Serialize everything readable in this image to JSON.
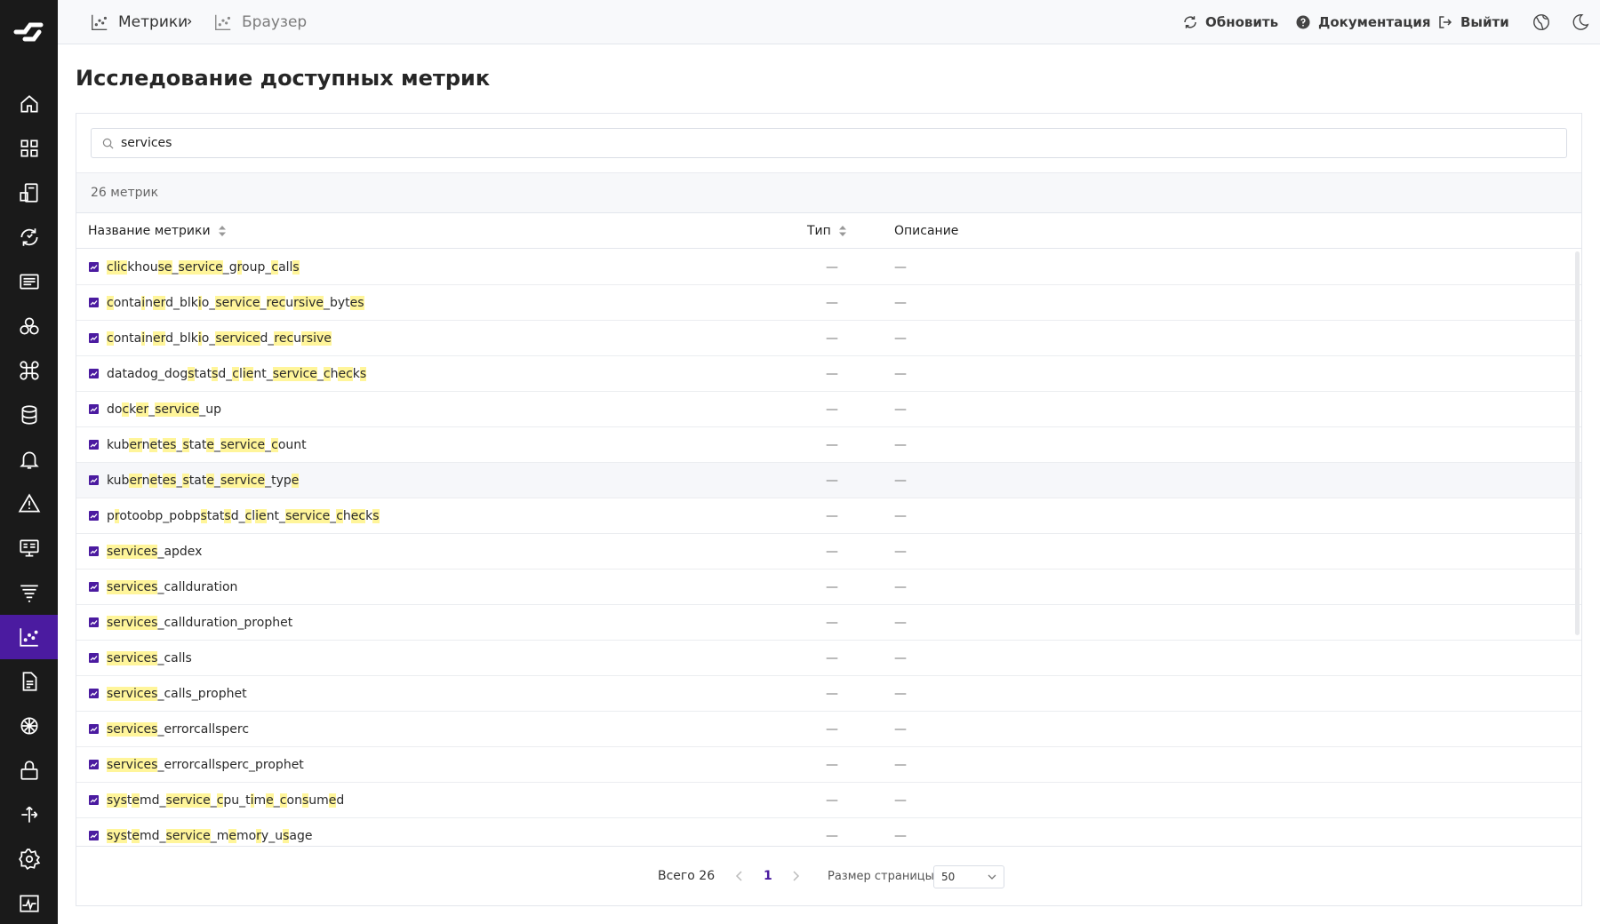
{
  "breadcrumb": {
    "item1": "Метрики",
    "separator": "›",
    "item2": "Браузер"
  },
  "top_actions": {
    "refresh": "Обновить",
    "docs": "Документация",
    "logout": "Выйти"
  },
  "page_title": "Исследование доступных метрик",
  "search": {
    "value": "services"
  },
  "metrics_count": "26 метрик",
  "columns": {
    "name": "Название метрики",
    "type": "Тип",
    "description": "Описание"
  },
  "rows": [
    {
      "name_html": "<mark>clic</mark>khou<mark>se</mark>_<mark>service</mark>_g<mark>r</mark>oup_<mark>c</mark>all<mark>s</mark>",
      "type": "—",
      "description": "—"
    },
    {
      "name_html": "<mark>c</mark>onta<mark>i</mark>n<mark>er</mark>d_blk<mark>i</mark>o_<mark>service</mark>_<mark>rec</mark>u<mark>rsive</mark>_byt<mark>es</mark>",
      "type": "—",
      "description": "—"
    },
    {
      "name_html": "<mark>c</mark>onta<mark>i</mark>n<mark>er</mark>d_blk<mark>i</mark>o_<mark>service</mark>d_<mark>rec</mark>u<mark>rsive</mark>",
      "type": "—",
      "description": "—"
    },
    {
      "name_html": "datadog_dog<mark>s</mark>tat<mark>s</mark>d_<mark>c</mark>l<mark>ie</mark>nt_<mark>service</mark>_<mark>c</mark>h<mark>ec</mark>k<mark>s</mark>",
      "type": "—",
      "description": "—"
    },
    {
      "name_html": "do<mark>c</mark>k<mark>er</mark>_<mark>service</mark>_up",
      "type": "—",
      "description": "—"
    },
    {
      "name_html": "kub<mark>er</mark>n<mark>e</mark>t<mark>es</mark>_<mark>s</mark>tat<mark>e</mark>_<mark>service</mark>_<mark>c</mark>ount",
      "type": "—",
      "description": "—"
    },
    {
      "name_html": "kub<mark>er</mark>n<mark>e</mark>t<mark>es</mark>_<mark>s</mark>tat<mark>e</mark>_<mark>service</mark>_typ<mark>e</mark>",
      "type": "—",
      "description": "—"
    },
    {
      "name_html": "p<mark>r</mark>otoobp_pobp<mark>s</mark>tat<mark>s</mark>d_<mark>c</mark>l<mark>ie</mark>nt_<mark>service</mark>_<mark>c</mark>h<mark>ec</mark>k<mark>s</mark>",
      "type": "—",
      "description": "—"
    },
    {
      "name_html": "<mark>services</mark>_apdex",
      "type": "—",
      "description": "—"
    },
    {
      "name_html": "<mark>services</mark>_callduration",
      "type": "—",
      "description": "—"
    },
    {
      "name_html": "<mark>services</mark>_callduration_prophet",
      "type": "—",
      "description": "—"
    },
    {
      "name_html": "<mark>services</mark>_calls",
      "type": "—",
      "description": "—"
    },
    {
      "name_html": "<mark>services</mark>_calls_prophet",
      "type": "—",
      "description": "—"
    },
    {
      "name_html": "<mark>services</mark>_errorcallsperc",
      "type": "—",
      "description": "—"
    },
    {
      "name_html": "<mark>services</mark>_errorcallsperc_prophet",
      "type": "—",
      "description": "—"
    },
    {
      "name_html": "<mark>sys</mark>t<mark>e</mark>md_<mark>service</mark>_<mark>c</mark>pu_t<mark>i</mark>m<mark>e</mark>_<mark>c</mark>on<mark>s</mark>um<mark>e</mark>d",
      "type": "—",
      "description": "—"
    },
    {
      "name_html": "<mark>sys</mark>t<mark>e</mark>md_<mark>service</mark>_m<mark>e</mark>mo<mark>r</mark>y_u<mark>s</mark>age",
      "type": "—",
      "description": "—"
    }
  ],
  "pagination": {
    "total": "Всего 26",
    "current_page": "1",
    "page_size_label": "Размер страницы",
    "page_size": "50"
  },
  "colors": {
    "sidebar_bg": "#1a1a1a",
    "accent": "#4b1ba0",
    "highlight": "#fff59a"
  }
}
